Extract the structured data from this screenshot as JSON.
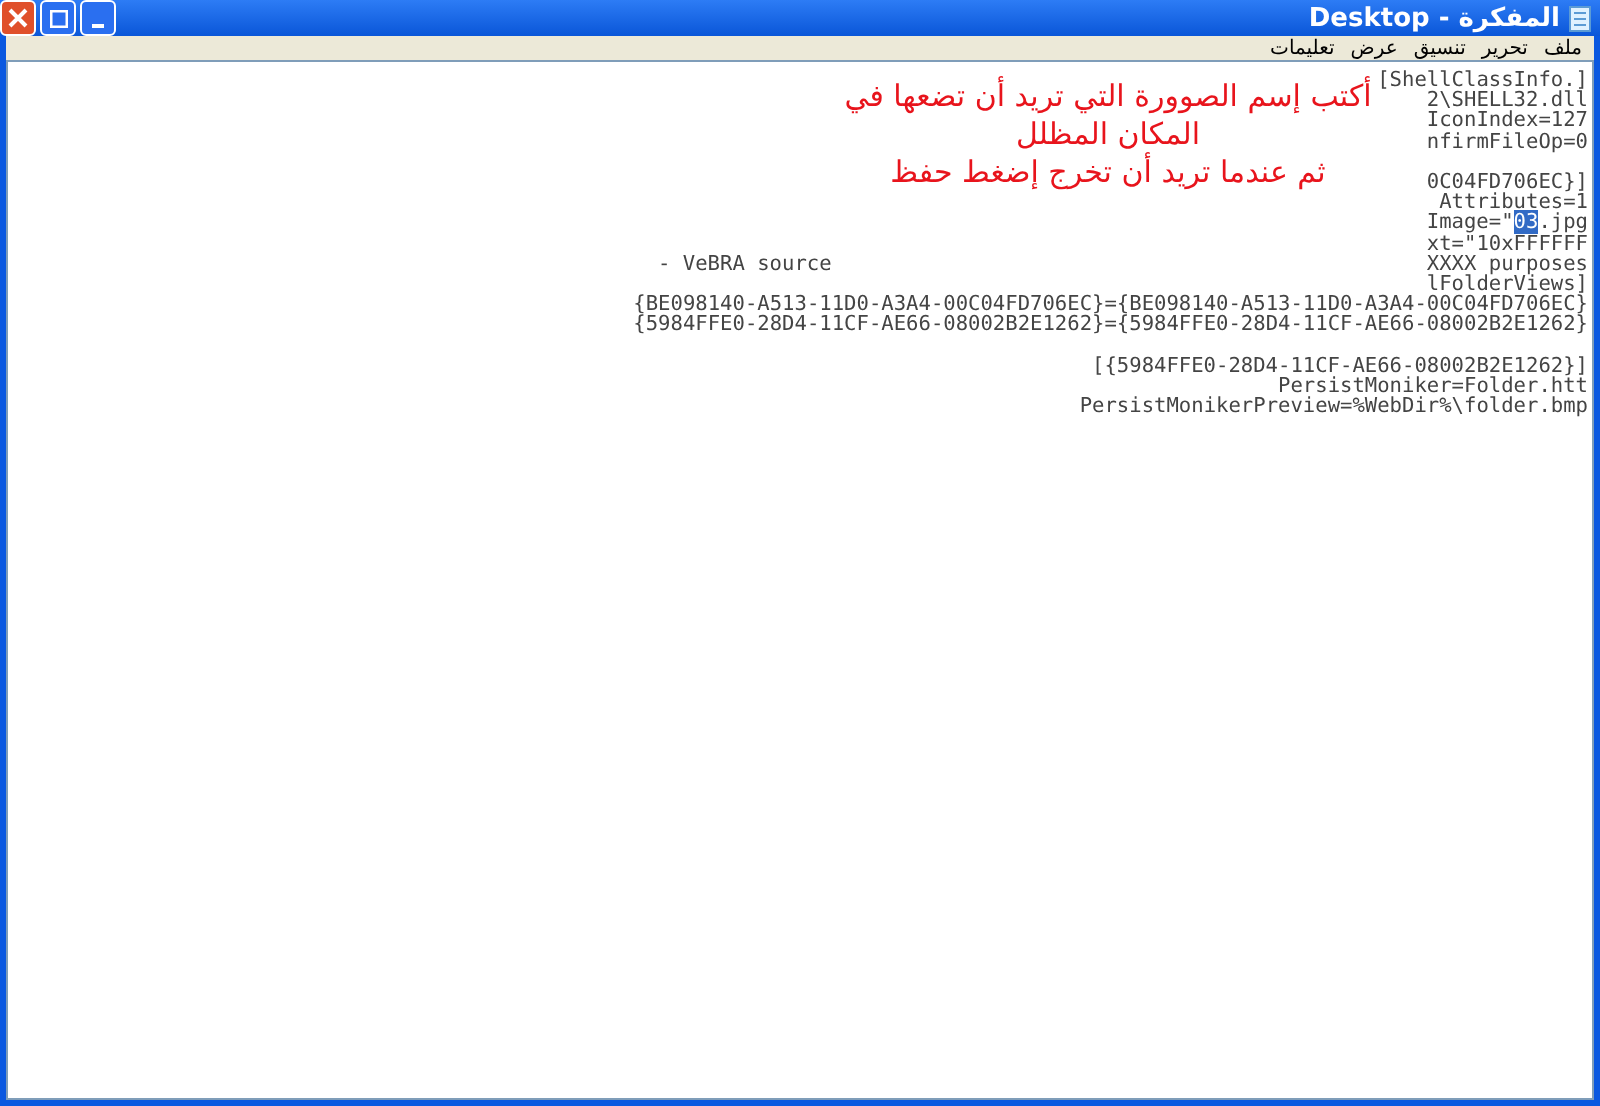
{
  "window": {
    "title": "المفكرة - Desktop"
  },
  "menu": [
    "ملف",
    "تحرير",
    "تنسيق",
    "عرض",
    "تعليمات"
  ],
  "annotation": [
    "أكتب إسم الصوورة   التي تريد أن تضعها في",
    "المكان المظلل",
    "ثم عندما تريد أن تخرج إضغط حفظ"
  ],
  "lines": [
    {
      "kind": "text",
      "text": "[ShellClassInfo.]"
    },
    {
      "kind": "text",
      "text": "2\\SHELL32.dll"
    },
    {
      "kind": "text",
      "text": "IconIndex=127"
    },
    {
      "kind": "text",
      "text": "nfirmFileOp=0"
    },
    {
      "kind": "blank"
    },
    {
      "kind": "text",
      "text": "0C04FD706EC}]"
    },
    {
      "kind": "text",
      "text": "Attributes=1"
    },
    {
      "kind": "selection",
      "text": "Image=\"",
      "selected_text": "03",
      "text_after": ".jpg"
    },
    {
      "kind": "text",
      "text": "xt=\"10xFFFFFF"
    },
    {
      "kind": "text",
      "side_note": "- VeBRA source",
      "text": "XXXX purposes"
    },
    {
      "kind": "text",
      "text": "lFolderViews]"
    },
    {
      "kind": "text",
      "text": "{BE098140-A513-11D0-A3A4-00C04FD706EC}={BE098140-A513-11D0-A3A4-00C04FD706EC}"
    },
    {
      "kind": "text",
      "text": "{5984FFE0-28D4-11CF-AE66-08002B2E1262}={5984FFE0-28D4-11CF-AE66-08002B2E1262}"
    },
    {
      "kind": "blank"
    },
    {
      "kind": "text",
      "text": "[{5984FFE0-28D4-11CF-AE66-08002B2E1262}]"
    },
    {
      "kind": "text",
      "text": "PersistMoniker=Folder.htt"
    },
    {
      "kind": "text",
      "text": "PersistMonikerPreview=%WebDir%\\folder.bmp"
    }
  ]
}
